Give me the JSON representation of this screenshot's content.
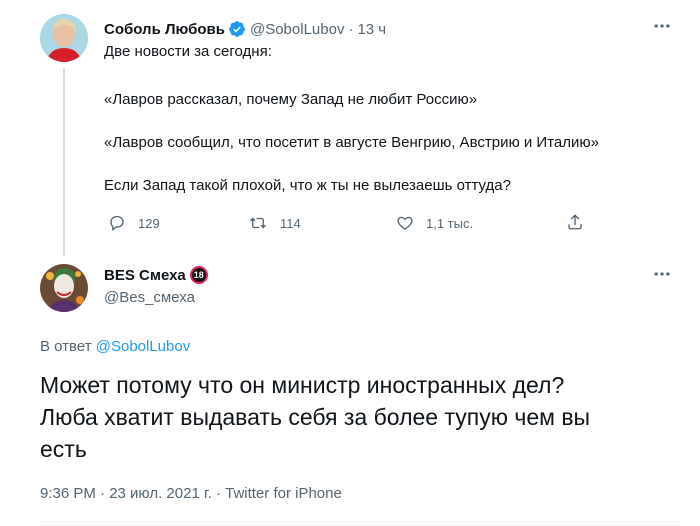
{
  "original_tweet": {
    "author_name": "Соболь Любовь",
    "handle": "@SobolLubov",
    "separator": "·",
    "time": "13 ч",
    "lines": [
      "Две новости за сегодня:",
      "«Лавров рассказал, почему Запад не любит Россию»",
      "«Лавров сообщил, что посетит в августе Венгрию, Австрию и Италию»",
      "Если Запад такой плохой, что ж ты не вылезаешь оттуда?"
    ],
    "replies_count": "129",
    "retweets_count": "114",
    "likes_count": "1,1 тыс.",
    "more_icon": "more-horizontal-icon",
    "verified_color": "#1d9bf0"
  },
  "reply_tweet": {
    "author_name": "BES Смеха",
    "badge": "18",
    "handle": "@Bes_смеха",
    "reply_prefix": "В ответ",
    "reply_to": "@SobolLubov",
    "lines": [
      "Может потому что он министр иностранных дел?",
      "Люба хватит выдавать себя за более тупую чем вы",
      "есть"
    ],
    "timestamp": "9:36 PM · 23 июл. 2021 г. · Twitter for iPhone",
    "more_icon": "more-horizontal-icon"
  }
}
